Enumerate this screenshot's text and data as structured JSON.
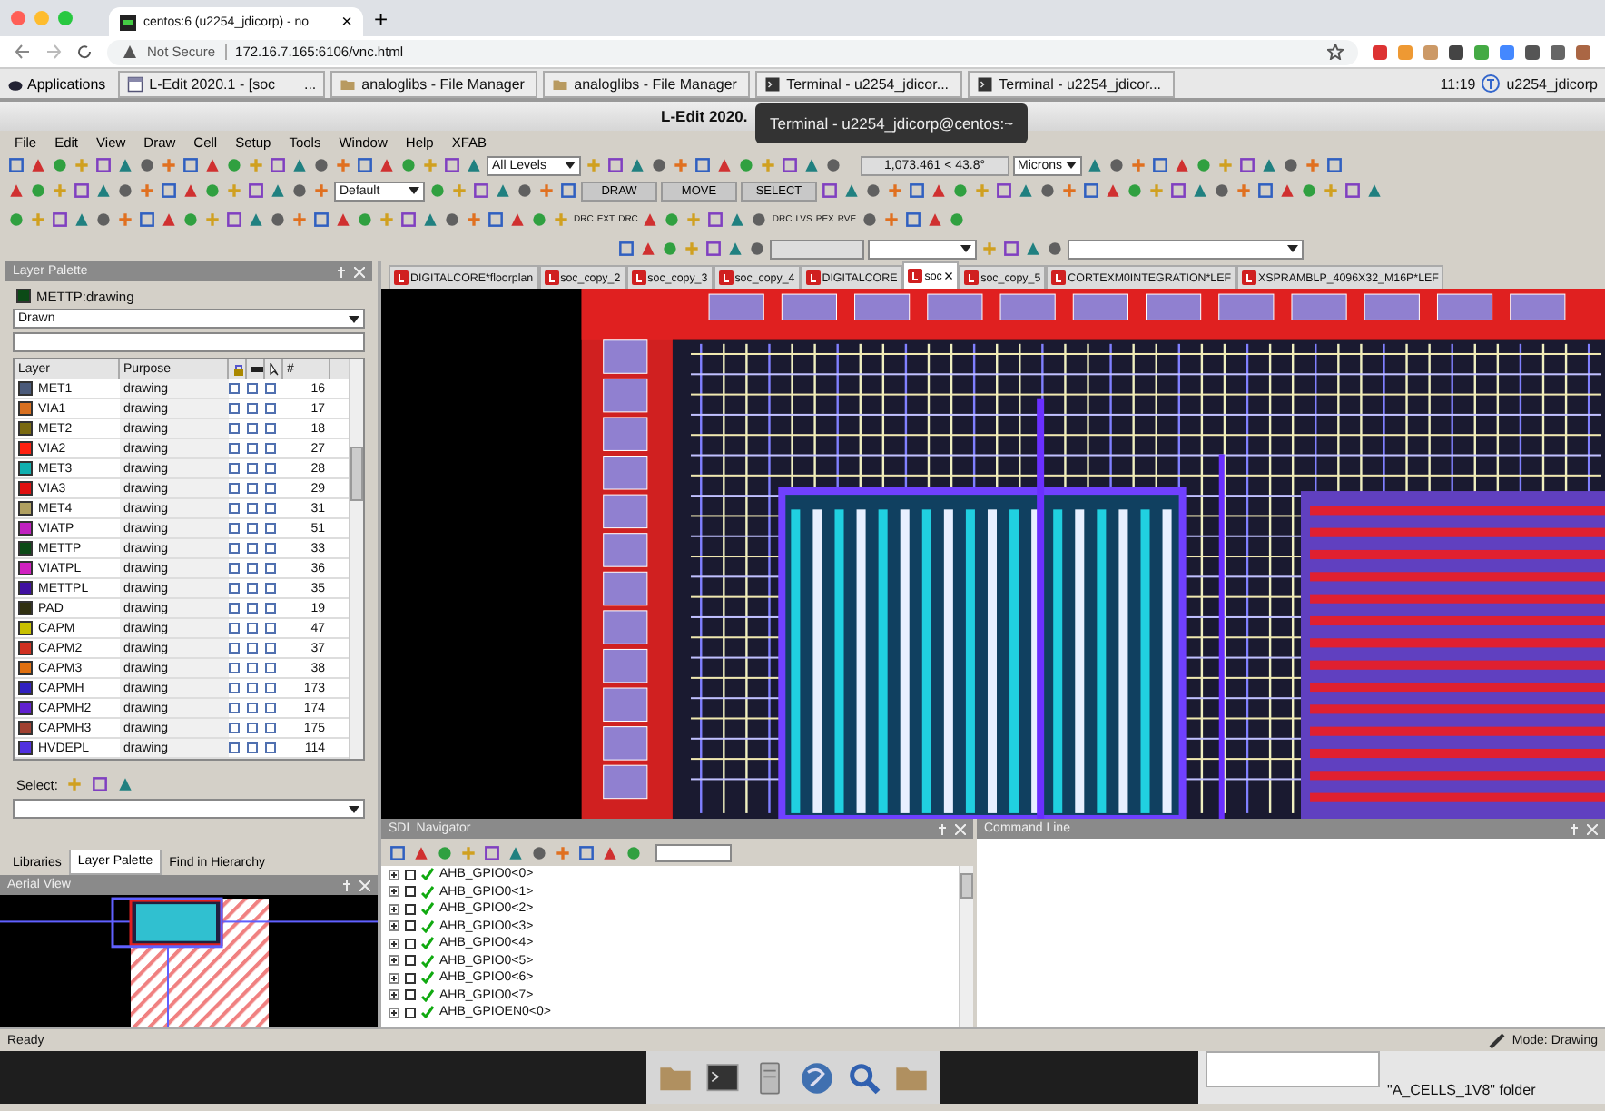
{
  "browser": {
    "tab_title": "centos:6 (u2254_jdicorp) - no",
    "tab_close": "×",
    "new_tab": "+",
    "security": "Not Secure",
    "url": "172.16.7.165:6106/vnc.html"
  },
  "desktop_taskbar": {
    "start": "Applications",
    "tasks": [
      {
        "kind": "window",
        "label": "L-Edit 2020.1 - [soc",
        "more": "..."
      },
      {
        "kind": "folder",
        "label": "analoglibs - File Manager"
      },
      {
        "kind": "folder",
        "label": "analoglibs - File Manager"
      },
      {
        "kind": "terminal",
        "label": "Terminal - u2254_jdicor..."
      },
      {
        "kind": "terminal",
        "label": "Terminal - u2254_jdicor..."
      }
    ],
    "clock": "11:19",
    "user": "u2254_jdicorp"
  },
  "window": {
    "title": "L-Edit 2020.",
    "tooltip": "Terminal - u2254_jdicorp@centos:~"
  },
  "menu": [
    "File",
    "Edit",
    "View",
    "Draw",
    "Cell",
    "Setup",
    "Tools",
    "Window",
    "Help",
    "XFAB"
  ],
  "toolbar": {
    "levels": "All Levels",
    "coordinates": "1,073.461 < 43.8°",
    "units": "Microns",
    "style": "Default",
    "modes": [
      "DRAW",
      "MOVE",
      "SELECT"
    ],
    "drc_labels": [
      "DRC",
      "EXT",
      "DRC"
    ],
    "verify_labels": [
      "DRC",
      "LVS",
      "PEX",
      "RVE"
    ]
  },
  "layer_palette": {
    "title": "Layer Palette",
    "current_layer": {
      "name": "METTP:drawing",
      "color": "#0b4a16"
    },
    "view": "Drawn",
    "columns": [
      "Layer",
      "Purpose",
      "#"
    ],
    "layers": [
      {
        "name": "MET1",
        "purpose": "drawing",
        "number": "16",
        "color": "#4a5a7a",
        "flags": [
          false,
          false,
          false
        ]
      },
      {
        "name": "VIA1",
        "purpose": "drawing",
        "number": "17",
        "color": "#d87020",
        "flags": [
          false,
          false,
          false
        ]
      },
      {
        "name": "MET2",
        "purpose": "drawing",
        "number": "18",
        "color": "#7a6a10",
        "flags": [
          false,
          false,
          false
        ]
      },
      {
        "name": "VIA2",
        "purpose": "drawing",
        "number": "27",
        "color": "#ff2010",
        "flags": [
          false,
          false,
          false
        ]
      },
      {
        "name": "MET3",
        "purpose": "drawing",
        "number": "28",
        "color": "#10b0b0",
        "flags": [
          false,
          false,
          false
        ]
      },
      {
        "name": "VIA3",
        "purpose": "drawing",
        "number": "29",
        "color": "#e01010",
        "flags": [
          false,
          false,
          false
        ]
      },
      {
        "name": "MET4",
        "purpose": "drawing",
        "number": "31",
        "color": "#b0a060",
        "flags": [
          false,
          false,
          false
        ]
      },
      {
        "name": "VIATP",
        "purpose": "drawing",
        "number": "51",
        "color": "#c020c0",
        "flags": [
          false,
          false,
          false
        ]
      },
      {
        "name": "METTP",
        "purpose": "drawing",
        "number": "33",
        "color": "#0b4a16",
        "flags": [
          false,
          false,
          false
        ]
      },
      {
        "name": "VIATPL",
        "purpose": "drawing",
        "number": "36",
        "color": "#d020c0",
        "flags": [
          false,
          false,
          false
        ]
      },
      {
        "name": "METTPL",
        "purpose": "drawing",
        "number": "35",
        "color": "#4010a0",
        "flags": [
          false,
          false,
          false
        ]
      },
      {
        "name": "PAD",
        "purpose": "drawing",
        "number": "19",
        "color": "#303010",
        "flags": [
          false,
          false,
          false
        ]
      },
      {
        "name": "CAPM",
        "purpose": "drawing",
        "number": "47",
        "color": "#c8c000",
        "flags": [
          false,
          false,
          false
        ]
      },
      {
        "name": "CAPM2",
        "purpose": "drawing",
        "number": "37",
        "color": "#d03020",
        "flags": [
          false,
          false,
          false
        ]
      },
      {
        "name": "CAPM3",
        "purpose": "drawing",
        "number": "38",
        "color": "#e07010",
        "flags": [
          false,
          false,
          false
        ]
      },
      {
        "name": "CAPMH",
        "purpose": "drawing",
        "number": "173",
        "color": "#3020c0",
        "flags": [
          false,
          false,
          false
        ]
      },
      {
        "name": "CAPMH2",
        "purpose": "drawing",
        "number": "174",
        "color": "#6020d0",
        "flags": [
          false,
          false,
          false
        ]
      },
      {
        "name": "CAPMH3",
        "purpose": "drawing",
        "number": "175",
        "color": "#a04030",
        "flags": [
          false,
          false,
          false
        ]
      },
      {
        "name": "HVDEPL",
        "purpose": "drawing",
        "number": "114",
        "color": "#5030e0",
        "flags": [
          false,
          false,
          false
        ]
      }
    ],
    "select_label": "Select:"
  },
  "left_tabs": [
    {
      "label": "Libraries",
      "selected": false
    },
    {
      "label": "Layer Palette",
      "selected": true
    },
    {
      "label": "Find in Hierarchy",
      "selected": false
    }
  ],
  "aerial_view": {
    "title": "Aerial View"
  },
  "document_tabs": [
    {
      "label": "DIGITALCORE*floorplan",
      "selected": false
    },
    {
      "label": "soc_copy_2",
      "selected": false
    },
    {
      "label": "soc_copy_3",
      "selected": false
    },
    {
      "label": "soc_copy_4",
      "selected": false
    },
    {
      "label": "DIGITALCORE",
      "selected": false
    },
    {
      "label": "soc",
      "selected": true,
      "close": "×"
    },
    {
      "label": "soc_copy_5",
      "selected": false
    },
    {
      "label": "CORTEXM0INTEGRATION*LEF",
      "selected": false
    },
    {
      "label": "XSPRAMBLP_4096X32_M16P*LEF",
      "selected": false
    }
  ],
  "sdl_navigator": {
    "title": "SDL Navigator",
    "nets": [
      {
        "name": "AHB_GPIO0<0>",
        "checked": false
      },
      {
        "name": "AHB_GPIO0<1>",
        "checked": false
      },
      {
        "name": "AHB_GPIO0<2>",
        "checked": false
      },
      {
        "name": "AHB_GPIO0<3>",
        "checked": false
      },
      {
        "name": "AHB_GPIO0<4>",
        "checked": false
      },
      {
        "name": "AHB_GPIO0<5>",
        "checked": false
      },
      {
        "name": "AHB_GPIO0<6>",
        "checked": false
      },
      {
        "name": "AHB_GPIO0<7>",
        "checked": false
      },
      {
        "name": "AHB_GPIOEN0<0>",
        "checked": false
      }
    ]
  },
  "command_line": {
    "title": "Command Line"
  },
  "status_bar": {
    "message": "Ready",
    "mode": "Mode: Drawing"
  },
  "notification": {
    "text": "\"A_CELLS_1V8\" folder"
  },
  "dock": [
    {
      "kind": "folder"
    },
    {
      "kind": "terminal"
    },
    {
      "kind": "drive"
    },
    {
      "kind": "globe"
    },
    {
      "kind": "search"
    },
    {
      "kind": "folder"
    }
  ]
}
